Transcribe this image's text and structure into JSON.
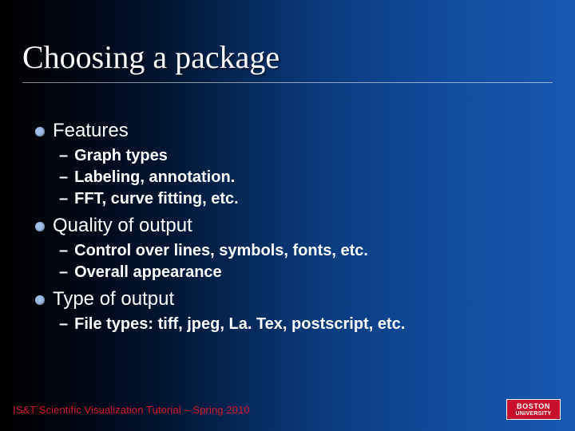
{
  "slide": {
    "title": "Choosing a package",
    "bullets": [
      {
        "label": "Features",
        "sub": [
          "Graph types",
          "Labeling, annotation.",
          "FFT, curve fitting, etc."
        ]
      },
      {
        "label": "Quality of output",
        "sub": [
          "Control over lines, symbols, fonts, etc.",
          "Overall appearance"
        ]
      },
      {
        "label": "Type of output",
        "sub": [
          "File types: tiff, jpeg, La. Tex, postscript, etc."
        ]
      }
    ]
  },
  "footer": {
    "text": "IS&T Scientific Visualization Tutorial – Spring 2010",
    "logo_line1": "BOSTON",
    "logo_line2": "UNIVERSITY"
  }
}
